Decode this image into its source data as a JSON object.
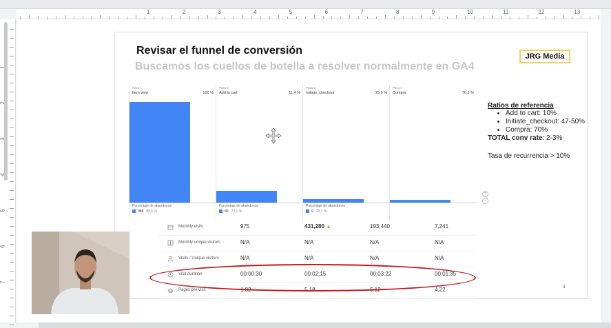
{
  "ruler": {
    "numbers": [
      "1",
      "2",
      "3",
      "4",
      "5",
      "6",
      "7",
      "8",
      "9",
      "10",
      "11",
      "12",
      "13"
    ],
    "left_numbers": [
      "1",
      "2",
      "3",
      "4",
      "5",
      "6",
      "7"
    ]
  },
  "slide": {
    "title": "Revisar el funnel de conversión",
    "subtitle": "Buscamos los cuellos de botella a resolver normalmente en GA4",
    "brand": "JRG Media",
    "page_number": "3"
  },
  "funnel": {
    "steps": [
      {
        "num": "Paso 1",
        "name": "Item view",
        "pct": "100 %",
        "value": 100,
        "ab_label": "Porcentaje de abandonos",
        "ab_count": "986",
        "ab_pct": "88,6 %"
      },
      {
        "num": "Paso 2",
        "name": "Add to cart",
        "pct": "11,4 %",
        "value": 11.4,
        "ab_label": "Porcentaje de abandonos",
        "ab_count": "89",
        "ab_pct": "70,1 %"
      },
      {
        "num": "Paso 3",
        "name": "Initiate_checkout",
        "pct": "29,9 %",
        "value": 3.4,
        "ab_label": "Porcentaje de abandonos",
        "ab_count": "9",
        "ab_pct": "23,7 %"
      },
      {
        "num": "Paso 4",
        "name": "Compra",
        "pct": "76,3 %",
        "value": 2.6
      }
    ]
  },
  "metrics": {
    "rows": [
      {
        "icon": "calendar-icon",
        "label": "Monthly visits",
        "values": [
          "975",
          "431,280",
          "193,440",
          "7,241"
        ],
        "highlight_index": 1
      },
      {
        "icon": "grid-icon",
        "label": "Monthly unique visitors",
        "values": [
          "N/A",
          "N/A",
          "N/A",
          "N/A"
        ]
      },
      {
        "icon": "person-icon",
        "label": "Visits / Unique visitors",
        "values": [
          "N/A",
          "N/A",
          "N/A",
          "N/A"
        ]
      },
      {
        "icon": "clock-icon",
        "label": "Visit duration",
        "values": [
          "00:00:30",
          "00:02:15",
          "00:03:22",
          "00:01:35"
        ]
      },
      {
        "icon": "layers-icon",
        "label": "Pages per visit",
        "values": [
          "1.82",
          "5.18",
          "5.12",
          "4.22"
        ]
      }
    ]
  },
  "ratios": {
    "title": "Ratios de referencia",
    "items": [
      "Add to cart: 10%",
      "Initiate_checkout: 47-50%",
      "Compra: 70%"
    ],
    "total_label": "TOTAL conv rate",
    "total_value": ": 2-3%",
    "recurrence": "Tasa de recurrencia > 10%"
  },
  "colors": {
    "bar": "#4285f4",
    "annotation": "#c0191b",
    "brand_border": "#f2d44a",
    "subtitle": "#c8c8c8"
  }
}
